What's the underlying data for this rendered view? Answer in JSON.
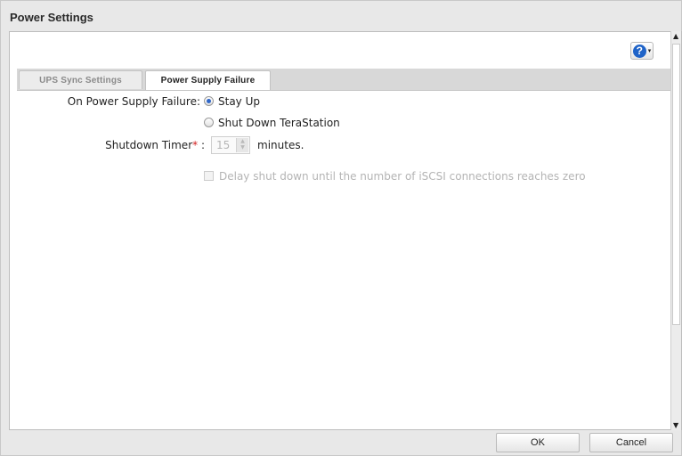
{
  "dialog": {
    "title": "Power Settings"
  },
  "help": {
    "icon": "help-icon",
    "glyph": "?",
    "caret": "▾"
  },
  "tabs": [
    {
      "label": "UPS Sync Settings",
      "active": false
    },
    {
      "label": "Power Supply Failure",
      "active": true
    }
  ],
  "form": {
    "on_failure_label": "On Power Supply Failure:",
    "options": [
      {
        "label": "Stay Up",
        "selected": true
      },
      {
        "label": "Shut Down TeraStation",
        "selected": false
      }
    ],
    "timer_label": "Shutdown Timer",
    "timer_required_mark": "*",
    "timer_colon": ":",
    "timer_value": "15",
    "timer_unit": "minutes.",
    "iscsi_checkbox_label": "Delay shut down until the number of iSCSI connections reaches zero",
    "iscsi_checked": false
  },
  "footer": {
    "ok_label": "OK",
    "cancel_label": "Cancel"
  },
  "colors": {
    "accent": "#2f66c8",
    "help_icon": "#1f63c8",
    "required": "#d21f1f"
  }
}
